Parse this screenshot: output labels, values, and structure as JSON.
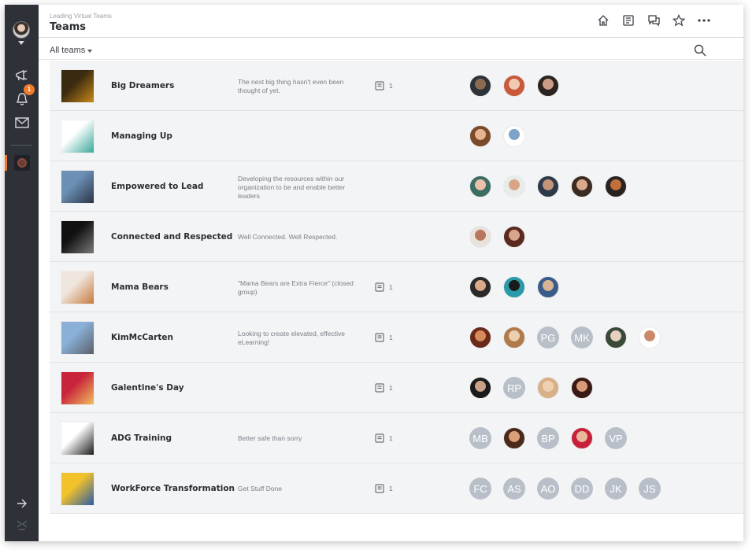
{
  "app": {
    "breadcrumb": "Leading Virtual Teams",
    "title": "Teams",
    "notification_count": "1"
  },
  "filter": {
    "label": "All teams"
  },
  "icons": {
    "header": [
      "home-icon",
      "library-icon",
      "chat-icon",
      "star-icon",
      "more-icon"
    ],
    "sidebar": [
      "megaphone-icon",
      "bell-icon",
      "mail-icon",
      "arrow-right-icon",
      "collapse-icon"
    ]
  },
  "teams": [
    {
      "name": "Big Dreamers",
      "description": "The next big thing hasn't even been thought of yet.",
      "courses": "1",
      "thumb": [
        "#3a2a10",
        "#c9891a"
      ],
      "members": [
        {
          "type": "photo",
          "colors": [
            "#2d3238",
            "#8b6a52"
          ]
        },
        {
          "type": "photo",
          "colors": [
            "#c9593b",
            "#f0c9b0"
          ]
        },
        {
          "type": "photo",
          "colors": [
            "#2a2420",
            "#c99c85"
          ]
        }
      ]
    },
    {
      "name": "Managing Up",
      "description": "",
      "courses": "",
      "thumb": [
        "#ffffff",
        "#3aa79a"
      ],
      "members": [
        {
          "type": "photo",
          "colors": [
            "#7a4a2a",
            "#e6b48e"
          ]
        },
        {
          "type": "photo",
          "colors": [
            "#ffffff",
            "#7da3c8"
          ]
        }
      ]
    },
    {
      "name": "Empowered to Lead",
      "description": "Developing the resources within our organization to be and enable better leaders",
      "courses": "",
      "thumb": [
        "#6b8fb5",
        "#2a3444"
      ],
      "members": [
        {
          "type": "photo",
          "colors": [
            "#3c6d64",
            "#e8c1a8"
          ]
        },
        {
          "type": "photo",
          "colors": [
            "#e8ece8",
            "#d9a586"
          ]
        },
        {
          "type": "photo",
          "colors": [
            "#2c3a4a",
            "#c49478"
          ]
        },
        {
          "type": "photo",
          "colors": [
            "#3a2c22",
            "#d8a98a"
          ]
        },
        {
          "type": "photo",
          "colors": [
            "#2a2222",
            "#c2703a"
          ]
        }
      ]
    },
    {
      "name": "Connected and Respected",
      "description": "Well Connected. Well Respected.",
      "courses": "",
      "thumb": [
        "#111111",
        "#7a7a7a"
      ],
      "members": [
        {
          "type": "photo",
          "colors": [
            "#e8e2dc",
            "#b8765c"
          ]
        },
        {
          "type": "photo",
          "colors": [
            "#5a2a20",
            "#d9a48c"
          ]
        }
      ]
    },
    {
      "name": "Mama Bears",
      "description": "\"Mama Bears are Extra Fierce\" (closed group)",
      "courses": "1",
      "thumb": [
        "#efe6de",
        "#c77a3c"
      ],
      "members": [
        {
          "type": "photo",
          "colors": [
            "#2a2a2a",
            "#d9a98a"
          ]
        },
        {
          "type": "photo",
          "colors": [
            "#2a9aa8",
            "#1a1a1a"
          ]
        },
        {
          "type": "photo",
          "colors": [
            "#3a5c8a",
            "#d8b494"
          ]
        }
      ]
    },
    {
      "name": "KimMcCarten",
      "description": "Looking to create elevated, effective eLearning!",
      "courses": "1",
      "thumb": [
        "#8ab0d8",
        "#5a6068"
      ],
      "members": [
        {
          "type": "photo",
          "colors": [
            "#6a2a1a",
            "#d98a5a"
          ]
        },
        {
          "type": "photo",
          "colors": [
            "#b07a4a",
            "#ead0b0"
          ]
        },
        {
          "type": "initials",
          "text": "PG"
        },
        {
          "type": "initials",
          "text": "MK"
        },
        {
          "type": "photo",
          "colors": [
            "#3a4a3a",
            "#e8d0c0"
          ]
        },
        {
          "type": "photo",
          "colors": [
            "#ffffff",
            "#c98a6a"
          ]
        }
      ]
    },
    {
      "name": "Galentine's Day",
      "description": "",
      "courses": "1",
      "thumb": [
        "#c8253a",
        "#f0c060"
      ],
      "members": [
        {
          "type": "photo",
          "colors": [
            "#1a1a1a",
            "#c9a088"
          ]
        },
        {
          "type": "initials",
          "text": "RP"
        },
        {
          "type": "photo",
          "colors": [
            "#d8b088",
            "#f0d0b0"
          ]
        },
        {
          "type": "photo",
          "colors": [
            "#3a1a14",
            "#d99a7a"
          ]
        }
      ]
    },
    {
      "name": "ADG Training",
      "description": "Better safe than sorry",
      "courses": "1",
      "thumb": [
        "#ffffff",
        "#1a1a1a"
      ],
      "members": [
        {
          "type": "initials",
          "text": "MB"
        },
        {
          "type": "photo",
          "colors": [
            "#4a2a1a",
            "#d9a07a"
          ]
        },
        {
          "type": "initials",
          "text": "BP"
        },
        {
          "type": "photo",
          "colors": [
            "#c8203a",
            "#e8b89a"
          ]
        },
        {
          "type": "initials",
          "text": "VP"
        }
      ]
    },
    {
      "name": "WorkForce Transformation",
      "description": "Get Stuff Done",
      "courses": "1",
      "thumb": [
        "#f2c22a",
        "#2a5ca8"
      ],
      "members": [
        {
          "type": "initials",
          "text": "FC"
        },
        {
          "type": "initials",
          "text": "AS"
        },
        {
          "type": "initials",
          "text": "AO"
        },
        {
          "type": "initials",
          "text": "DD"
        },
        {
          "type": "initials",
          "text": "JK"
        },
        {
          "type": "initials",
          "text": "JS"
        }
      ]
    }
  ]
}
